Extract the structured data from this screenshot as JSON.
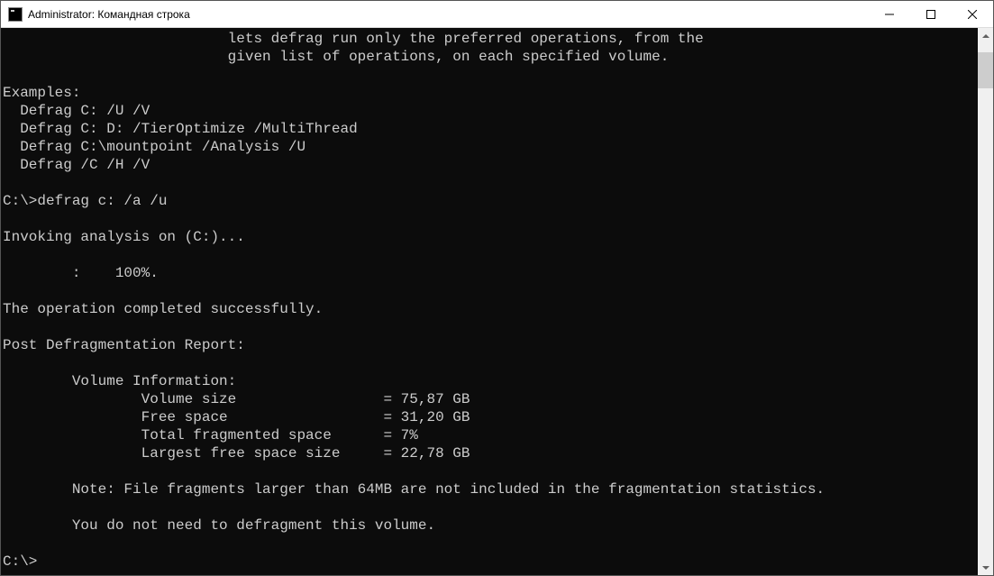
{
  "window": {
    "title": "Administrator: Командная строка"
  },
  "terminal": {
    "lines": [
      "                          lets defrag run only the preferred operations, from the",
      "                          given list of operations, on each specified volume.",
      "",
      "Examples:",
      "  Defrag C: /U /V",
      "  Defrag C: D: /TierOptimize /MultiThread",
      "  Defrag C:\\mountpoint /Analysis /U",
      "  Defrag /C /H /V",
      "",
      "C:\\>defrag c: /a /u",
      "",
      "Invoking analysis on (C:)...",
      "",
      "        :    100%.",
      "",
      "The operation completed successfully.",
      "",
      "Post Defragmentation Report:",
      "",
      "        Volume Information:",
      "                Volume size                 = 75,87 GB",
      "                Free space                  = 31,20 GB",
      "                Total fragmented space      = 7%",
      "                Largest free space size     = 22,78 GB",
      "",
      "        Note: File fragments larger than 64MB are not included in the fragmentation statistics.",
      "",
      "        You do not need to defragment this volume.",
      "",
      "C:\\>"
    ]
  }
}
